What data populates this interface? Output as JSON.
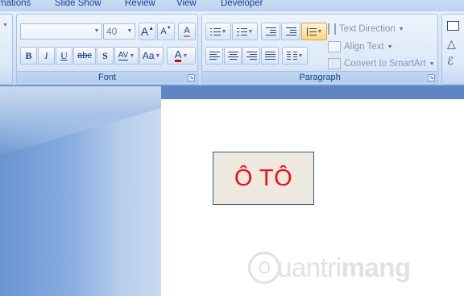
{
  "tabs": [
    "mations",
    "Slide Show",
    "Review",
    "View",
    "Developer"
  ],
  "font_group": {
    "label": "Font",
    "font_name": "",
    "font_size": "40",
    "grow_glyph": "A",
    "shrink_glyph": "A",
    "clear_glyph": "A",
    "bold": "B",
    "italic": "I",
    "underline": "U",
    "strike": "abc",
    "shadow": "S",
    "spacing": "AV",
    "case": "Aa",
    "color_glyph": "A"
  },
  "paragraph_group": {
    "label": "Paragraph",
    "text_direction": "Text Direction",
    "align_text": "Align Text",
    "convert_smartart": "Convert to SmartArt"
  },
  "slide": {
    "textbox_text": "Ô TÔ",
    "watermark_a": "uantri",
    "watermark_b": "mang"
  },
  "colors": {
    "accent": "#15428b",
    "text_red": "#ee1111",
    "font_color_bar": "#e00000"
  }
}
